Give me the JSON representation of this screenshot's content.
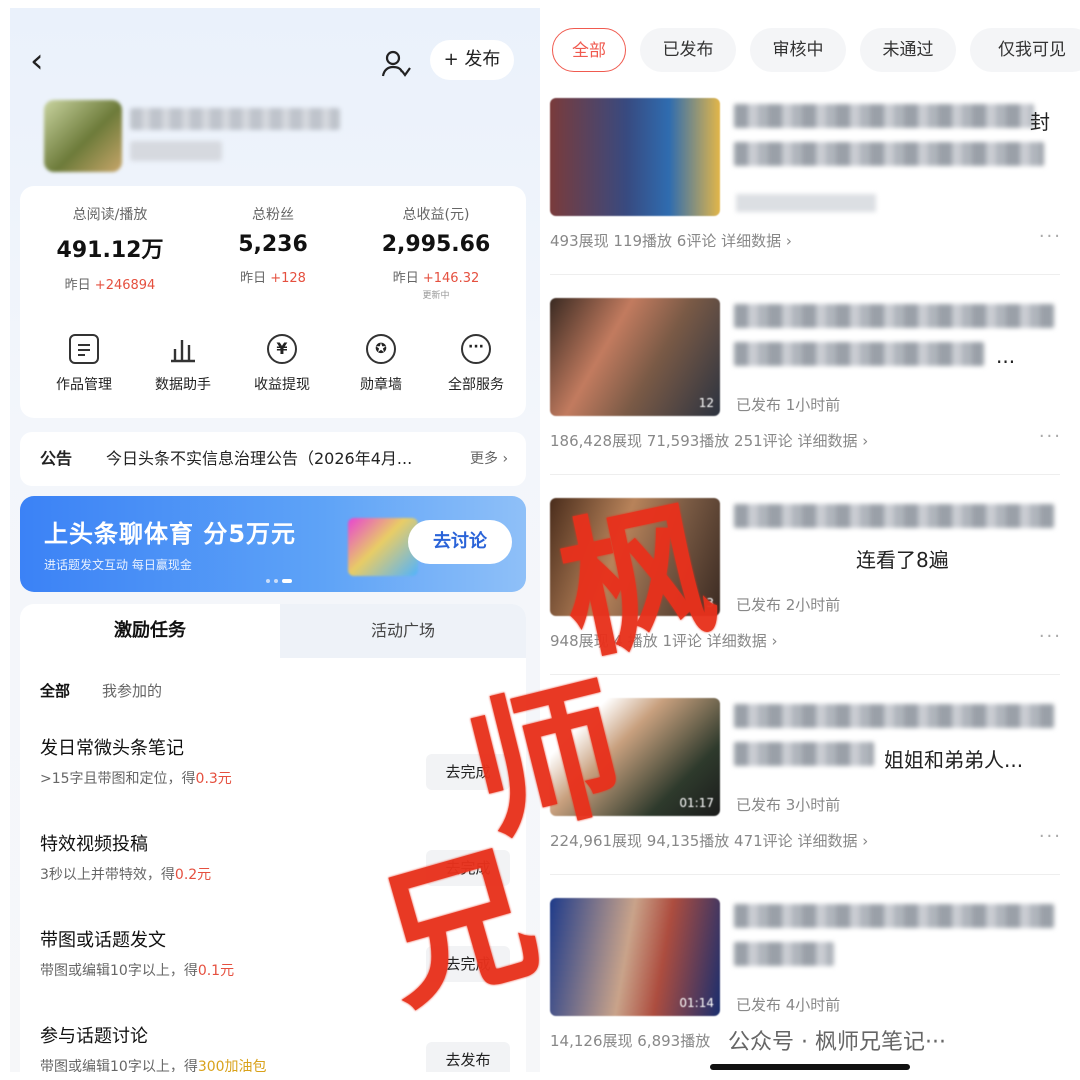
{
  "left": {
    "back_label": "‹",
    "publish_label": "+ 发布",
    "stats": [
      {
        "label": "总阅读/播放",
        "value": "491.12万",
        "sub_prefix": "昨日 ",
        "sub_delta": "+246894",
        "note": ""
      },
      {
        "label": "总粉丝",
        "value": "5,236",
        "sub_prefix": "昨日 ",
        "sub_delta": "+128",
        "note": ""
      },
      {
        "label": "总收益(元)",
        "value": "2,995.66",
        "sub_prefix": "昨日 ",
        "sub_delta": "+146.32",
        "note": "更新中"
      }
    ],
    "menu": [
      {
        "label": "作品管理",
        "icon": "document-icon"
      },
      {
        "label": "数据助手",
        "icon": "bar-chart-icon"
      },
      {
        "label": "收益提现",
        "icon": "yuan-icon"
      },
      {
        "label": "勋章墙",
        "icon": "medal-icon"
      },
      {
        "label": "全部服务",
        "icon": "more-icon"
      }
    ],
    "notice": {
      "key": "公告",
      "text": "今日头条不实信息治理公告（2026年4月...",
      "more": "更多 ›"
    },
    "banner": {
      "headline": "上头条聊体育 分5万元",
      "subline": "进话题发文互动 每日赢现金",
      "button": "去讨论"
    },
    "tasks_tabs": [
      "激励任务",
      "活动广场"
    ],
    "filters": [
      "全部",
      "我参加的"
    ],
    "tasks": [
      {
        "title": "发日常微头条笔记",
        "desc_prefix": ">15字且带图和定位，得",
        "reward": "0.3元",
        "action": "去完成"
      },
      {
        "title": "特效视频投稿",
        "desc_prefix": "3秒以上并带特效，得",
        "reward": "0.2元",
        "action": "去完成"
      },
      {
        "title": "带图或话题发文",
        "desc_prefix": "带图或编辑10字以上，得",
        "reward": "0.1元",
        "action": "去完成"
      },
      {
        "title": "参与话题讨论",
        "desc_prefix": "带图或编辑10字以上，得",
        "reward": "300加油包",
        "action": "去发布"
      }
    ]
  },
  "right": {
    "filter_tabs": [
      "全部",
      "已发布",
      "审核中",
      "未通过",
      "仅我可见"
    ],
    "items": [
      {
        "title_visible": "封",
        "status": "",
        "duration": "",
        "metrics": "493展现  119播放  6评论  详细数据 ›"
      },
      {
        "title_visible": "...",
        "status": "已发布  1小时前",
        "duration": "12",
        "metrics": "186,428展现  71,593播放  251评论  详细数据 ›"
      },
      {
        "title_visible": "连看了8遍",
        "status": "已发布  2小时前",
        "duration": "3",
        "metrics": "948展现  4  播放  1评论  详细数据 ›"
      },
      {
        "title_visible": "姐姐和弟弟人...",
        "status": "已发布  3小时前",
        "duration": "01:17",
        "metrics": "224,961展现  94,135播放  471评论  详细数据 ›"
      },
      {
        "title_visible": "",
        "status": "已发布  4小时前",
        "duration": "01:14",
        "metrics": "14,126展现  6,893播放"
      }
    ],
    "more_label": "···",
    "footer_watermark": "公众号 · 枫师兄笔记···"
  },
  "stamp": {
    "chars": [
      "枫",
      "师",
      "兄"
    ]
  },
  "colors": {
    "accent_red": "#e5503f",
    "tab_red": "#f05a4f",
    "banner_blue": "#3b82f6",
    "stamp_red": "#e8311c"
  }
}
